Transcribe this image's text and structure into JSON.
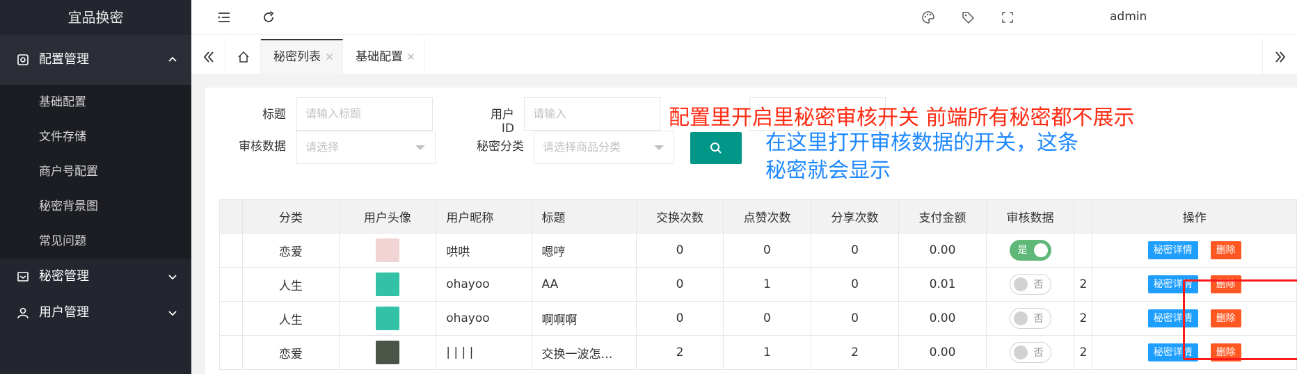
{
  "app": {
    "title": "宜品换密"
  },
  "sidebar": {
    "groups": [
      {
        "label": "配置管理",
        "icon": "settings-icon",
        "open": true,
        "items": [
          {
            "label": "基础配置"
          },
          {
            "label": "文件存储"
          },
          {
            "label": "商户号配置"
          },
          {
            "label": "秘密背景图"
          },
          {
            "label": "常见问题"
          }
        ]
      },
      {
        "label": "秘密管理",
        "icon": "mail-icon",
        "open": false
      },
      {
        "label": "用户管理",
        "icon": "user-icon",
        "open": false
      }
    ]
  },
  "header": {
    "user": "admin"
  },
  "tabs": [
    {
      "label": "秘密列表",
      "active": true
    },
    {
      "label": "基础配置",
      "active": false
    }
  ],
  "filters": {
    "title_label": "标题",
    "title_placeholder": "请输入标题",
    "userid_label": "用户ID",
    "userid_placeholder": "请输入",
    "review_label": "审核数据",
    "review_placeholder": "请选择",
    "category_label": "秘密分类",
    "category_placeholder": "请选择商品分类"
  },
  "annotations": {
    "red": "配置里开启里秘密审核开关 前端所有秘密都不展示",
    "blue": "在这里打开审核数据的开关，这条秘密就会显示"
  },
  "table": {
    "headers": [
      "分类",
      "用户头像",
      "用户昵称",
      "标题",
      "交换次数",
      "点赞次数",
      "分享次数",
      "支付金额",
      "审核数据",
      "",
      "操作"
    ],
    "rows": [
      {
        "category": "恋爱",
        "nickname": "哄哄",
        "title": "嗯哼",
        "exchanges": "0",
        "likes": "0",
        "shares": "0",
        "amount": "0.00",
        "review": "是",
        "review_on": true,
        "extra": "",
        "detail": "秘密详情",
        "delete": "删除",
        "avatar_color": "#f2d4d4"
      },
      {
        "category": "人生",
        "nickname": "ohayoo",
        "title": "AA",
        "exchanges": "0",
        "likes": "1",
        "shares": "0",
        "amount": "0.01",
        "review": "否",
        "review_on": false,
        "extra": "2",
        "detail": "秘密详情",
        "delete": "删除",
        "avatar_color": "#33c2a8"
      },
      {
        "category": "人生",
        "nickname": "ohayoo",
        "title": "啊啊啊",
        "exchanges": "0",
        "likes": "0",
        "shares": "0",
        "amount": "0.00",
        "review": "否",
        "review_on": false,
        "extra": "2",
        "detail": "秘密详情",
        "delete": "删除",
        "avatar_color": "#33c2a8"
      },
      {
        "category": "恋爱",
        "nickname": "| | | |",
        "title": "交换一波怎…",
        "exchanges": "2",
        "likes": "1",
        "shares": "2",
        "amount": "0.00",
        "review": "否",
        "review_on": false,
        "extra": "2",
        "detail": "秘密详情",
        "delete": "删除",
        "avatar_color": "#4a5548"
      }
    ]
  },
  "colors": {
    "sidebar_bg": "#23262e",
    "primary": "#009688",
    "switch_on": "#5fb878",
    "btn_blue": "#1e9fff",
    "btn_red": "#ff5722",
    "note_red": "#ff2a12",
    "note_blue": "#1e88ff"
  }
}
